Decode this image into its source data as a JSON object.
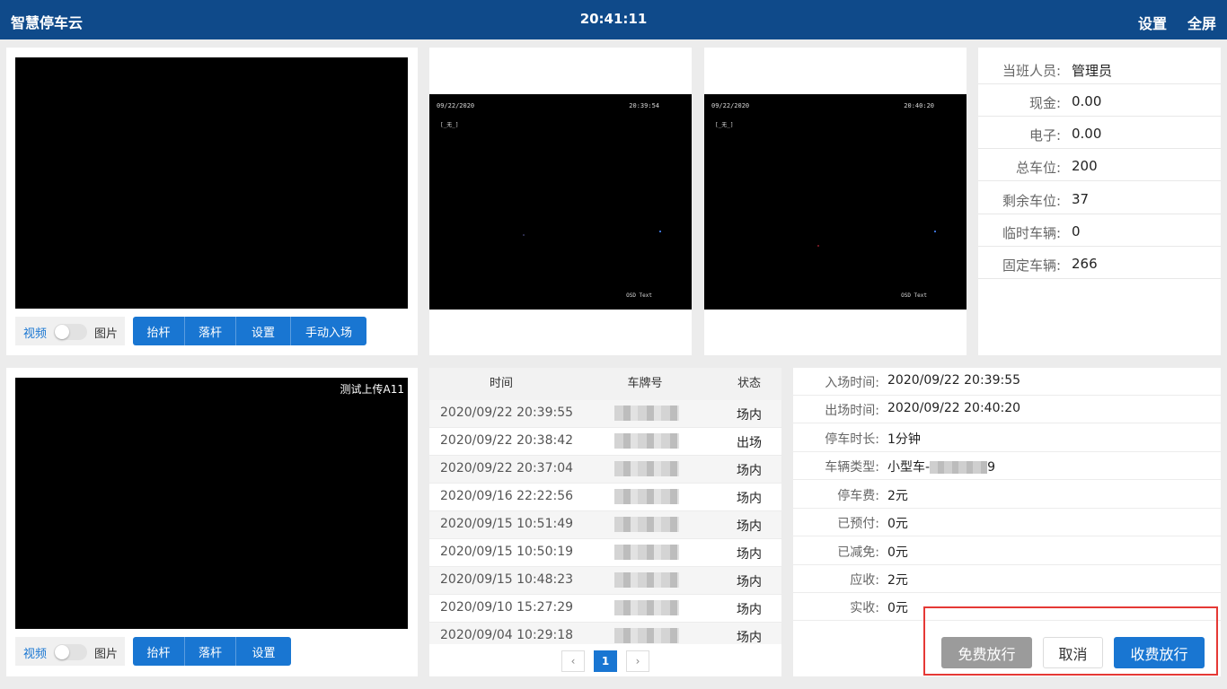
{
  "topbar": {
    "brand": "智慧停车云",
    "clock": "20:41:11",
    "settings_label": "设置",
    "fullscreen_label": "全屏"
  },
  "entry_camera": {
    "toggle_video_label": "视频",
    "toggle_picture_label": "图片",
    "buttons": [
      "抬杆",
      "落杆",
      "设置",
      "手动入场"
    ]
  },
  "exit_camera": {
    "caption": "测试上传A11",
    "toggle_video_label": "视频",
    "toggle_picture_label": "图片",
    "buttons": [
      "抬杆",
      "落杆",
      "设置"
    ]
  },
  "snapshots": [
    {
      "date": "09/22/2020",
      "time": "20:39:54",
      "tag": "[_无_]",
      "osd": "OSD Text"
    },
    {
      "date": "09/22/2020",
      "time": "20:40:20",
      "tag": "[_无_]",
      "osd": "OSD Text"
    }
  ],
  "shift_info": [
    {
      "label": "当班人员:",
      "value": "管理员"
    },
    {
      "label": "现金:",
      "value": "0.00"
    },
    {
      "label": "电子:",
      "value": "0.00"
    },
    {
      "label": "总车位:",
      "value": "200"
    },
    {
      "label": "剩余车位:",
      "value": "37"
    },
    {
      "label": "临时车辆:",
      "value": "0"
    },
    {
      "label": "固定车辆:",
      "value": "266"
    }
  ],
  "records": {
    "headers": {
      "time": "时间",
      "plate": "车牌号",
      "status": "状态"
    },
    "rows": [
      {
        "time": "2020/09/22 20:39:55",
        "status": "场内"
      },
      {
        "time": "2020/09/22 20:38:42",
        "status": "出场"
      },
      {
        "time": "2020/09/22 20:37:04",
        "status": "场内"
      },
      {
        "time": "2020/09/16 22:22:56",
        "status": "场内"
      },
      {
        "time": "2020/09/15 10:51:49",
        "status": "场内"
      },
      {
        "time": "2020/09/15 10:50:19",
        "status": "场内"
      },
      {
        "time": "2020/09/15 10:48:23",
        "status": "场内"
      },
      {
        "time": "2020/09/10 15:27:29",
        "status": "场内"
      },
      {
        "time": "2020/09/04 10:29:18",
        "status": "场内"
      }
    ],
    "pager": {
      "prev_icon": "‹",
      "current_page": "1",
      "next_icon": "›"
    }
  },
  "details": {
    "rows": [
      {
        "label": "入场时间:",
        "value": "2020/09/22 20:39:55"
      },
      {
        "label": "出场时间:",
        "value": "2020/09/22 20:40:20"
      },
      {
        "label": "停车时长:",
        "value": "1分钟"
      },
      {
        "label": "车辆类型:",
        "value": "小型车-",
        "value_tail": "9"
      },
      {
        "label": "停车费:",
        "value": "2元"
      },
      {
        "label": "已预付:",
        "value": "0元"
      },
      {
        "label": "已减免:",
        "value": "0元"
      },
      {
        "label": "应收:",
        "value": "2元"
      },
      {
        "label": "实收:",
        "value": "0元"
      }
    ],
    "actions": {
      "free_release": "免费放行",
      "cancel": "取消",
      "charge_release": "收费放行"
    }
  },
  "colors": {
    "topbar": "#0f4a8a",
    "primary": "#1976d2",
    "disabled": "#9b9b9b",
    "highlight_border": "#e53935"
  }
}
